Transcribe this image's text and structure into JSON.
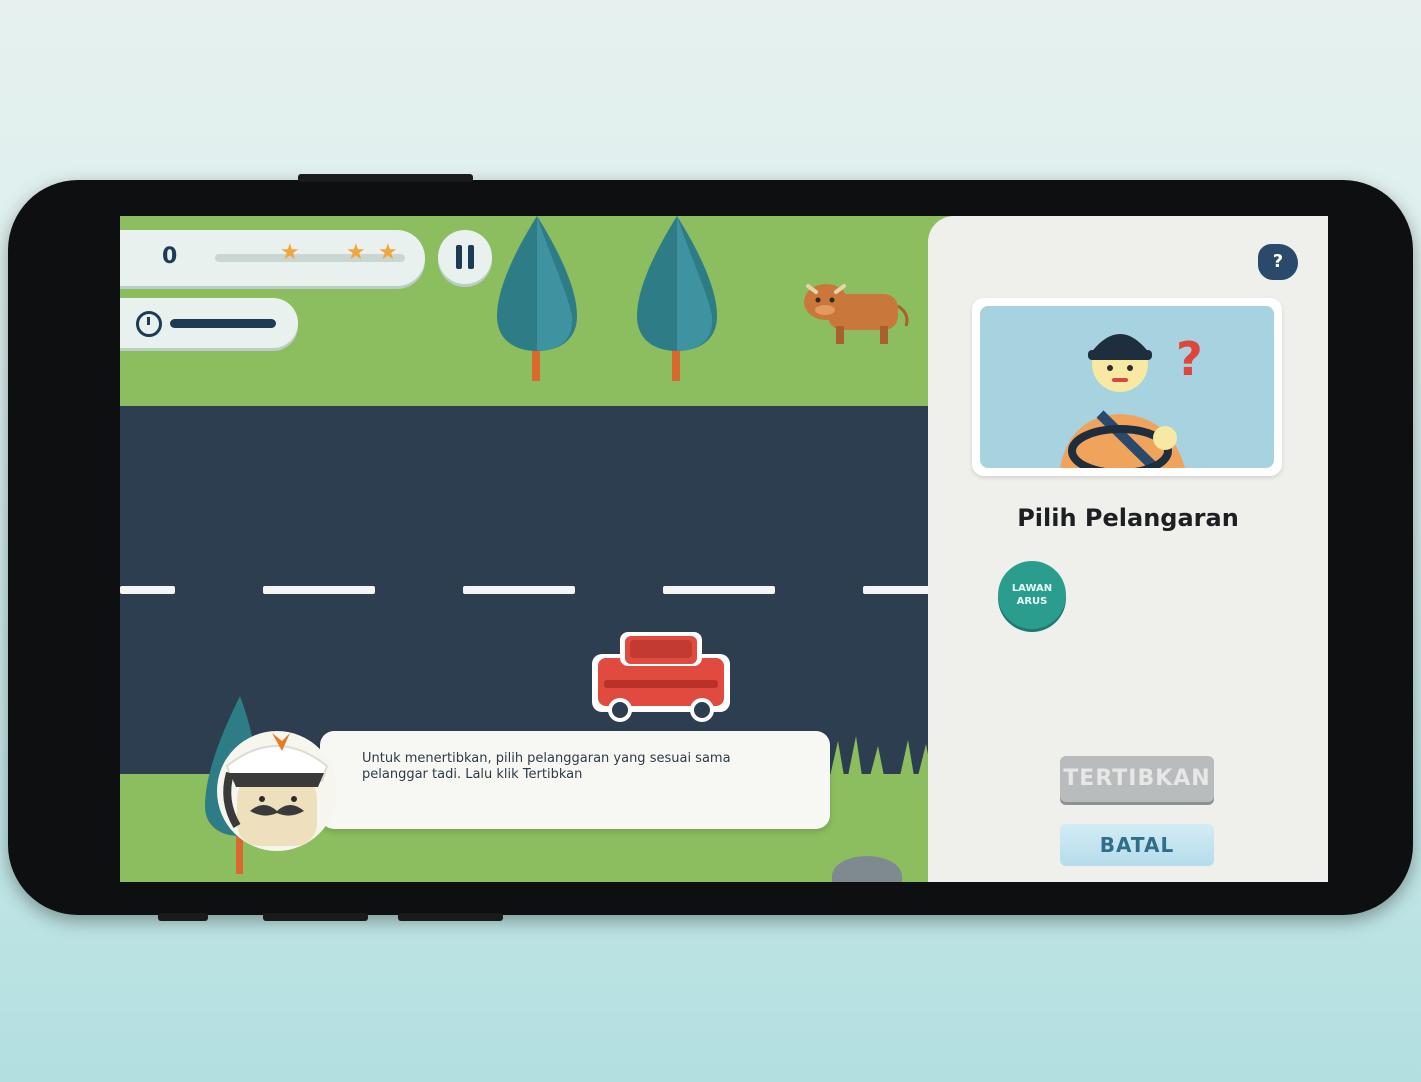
{
  "hud": {
    "score": "0",
    "stars": [
      "★",
      "★",
      "★"
    ]
  },
  "dialog": {
    "text": "Untuk menertibkan, pilih pelanggaran yang sesuai sama pelanggar tadi. Lalu klik Tertibkan"
  },
  "panel": {
    "help_label": "?",
    "title": "Pilih Pelangaran",
    "violations": [
      {
        "label": "LAWAN ARUS"
      }
    ],
    "tertibkan_label": "TERTIBKAN",
    "batal_label": "BATAL"
  },
  "suspect": {
    "question_mark": "?"
  },
  "colors": {
    "grass": "#8cbd5e",
    "road": "#2c3e50",
    "accent_teal": "#2a9d8f",
    "car_red": "#e04a3f",
    "navy": "#1e3b55"
  },
  "icons": [
    "clock-icon",
    "pause-icon",
    "help-icon",
    "star-icon"
  ]
}
